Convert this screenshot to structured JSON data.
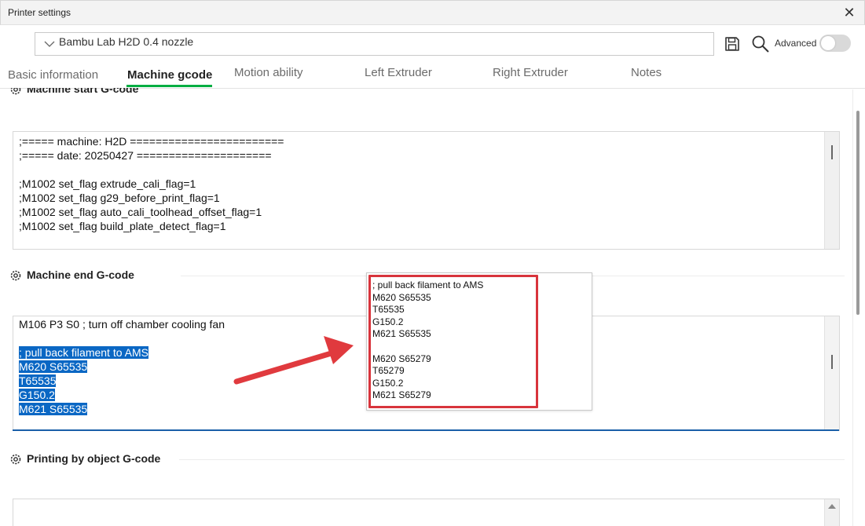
{
  "window": {
    "title": "Printer settings",
    "close_glyph": "✕"
  },
  "preset": {
    "name": "Bambu Lab H2D 0.4 nozzle"
  },
  "toolbar": {
    "advanced_label": "Advanced",
    "advanced_enabled": false
  },
  "tabs": [
    {
      "label": "Basic information",
      "active": false
    },
    {
      "label": "Machine gcode",
      "active": true
    },
    {
      "label": "Motion ability",
      "active": false
    },
    {
      "label": "Left Extruder",
      "active": false
    },
    {
      "label": "Right Extruder",
      "active": false
    },
    {
      "label": "Notes",
      "active": false
    }
  ],
  "sections": {
    "start": {
      "title": "Machine start G-code",
      "lines": [
        ";===== machine: H2D ========================",
        ";===== date: 20250427 =====================",
        "",
        ";M1002 set_flag extrude_cali_flag=1",
        ";M1002 set_flag g29_before_print_flag=1",
        ";M1002 set_flag auto_cali_toolhead_offset_flag=1",
        ";M1002 set_flag build_plate_detect_flag=1"
      ]
    },
    "end": {
      "title": "Machine end G-code",
      "lines": [
        "M106 P3 S0 ; turn off chamber cooling fan",
        "",
        "; pull back filament to AMS",
        "M620 S65535",
        "T65535",
        "G150.2",
        "M621 S65535"
      ]
    },
    "object": {
      "title": "Printing by object G-code"
    }
  },
  "popup": {
    "lines": [
      "; pull back filament to AMS",
      "M620 S65535",
      "T65535",
      "G150.2",
      "M621 S65535",
      "",
      "M620 S65279",
      "T65279",
      "G150.2",
      "M621 S65279"
    ]
  },
  "colors": {
    "accent_green": "#00ae42",
    "selection_blue": "#0a67c4",
    "annotation_red": "#e03a3e",
    "focus_blue": "#1a5fa8"
  },
  "icons": {
    "chevron": "chevron-down-icon",
    "save": "save-icon",
    "search": "search-icon",
    "gear": "gear-icon",
    "close": "close-icon"
  }
}
